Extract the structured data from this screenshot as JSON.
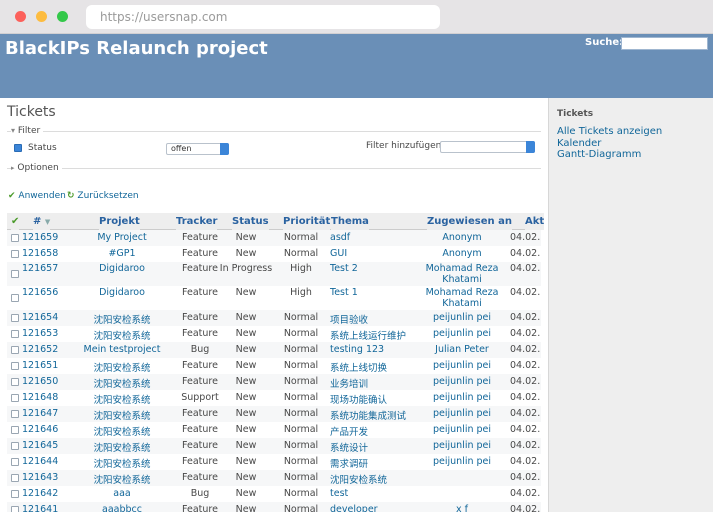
{
  "browser": {
    "url": "https://usersnap.com"
  },
  "header": {
    "project_title": "BlackIPs Relaunch project",
    "search_label": "Suche:"
  },
  "main": {
    "title": "Tickets",
    "filter_legend": "Filter",
    "status_label": "Status",
    "status_value": "offen",
    "add_filter_label": "Filter hinzufügen",
    "options_legend": "Optionen",
    "apply_label": "Anwenden",
    "reset_label": "Zurücksetzen"
  },
  "sidebar": {
    "title": "Tickets",
    "links": [
      "Alle Tickets anzeigen",
      "Kalender",
      "Gantt-Diagramm"
    ]
  },
  "table": {
    "headers": [
      "#",
      "Projekt",
      "Tracker",
      "Status",
      "Priorität",
      "Thema",
      "Zugewiesen an",
      "Akt"
    ],
    "rows": [
      {
        "id": "121659",
        "project": "My Project",
        "tracker": "Feature",
        "status": "New",
        "priority": "Normal",
        "subject": "asdf",
        "assignee": "Anonym",
        "assignee2": "",
        "updated": "04.02."
      },
      {
        "id": "121658",
        "project": "#GP1",
        "tracker": "Feature",
        "status": "New",
        "priority": "Normal",
        "subject": "GUI",
        "assignee": "Anonym",
        "assignee2": "",
        "updated": "04.02."
      },
      {
        "id": "121657",
        "project": "Digidaroo",
        "tracker": "Feature",
        "status": "In Progress",
        "priority": "High",
        "subject": "Test 2",
        "assignee": "Mohamad Reza",
        "assignee2": "Khatami",
        "updated": "04.02."
      },
      {
        "id": "121656",
        "project": "Digidaroo",
        "tracker": "Feature",
        "status": "New",
        "priority": "High",
        "subject": "Test 1",
        "assignee": "Mohamad Reza",
        "assignee2": "Khatami",
        "updated": "04.02."
      },
      {
        "id": "121654",
        "project": "沈阳安检系统",
        "tracker": "Feature",
        "status": "New",
        "priority": "Normal",
        "subject": "项目验收",
        "assignee": "peijunlin pei",
        "assignee2": "",
        "updated": "04.02."
      },
      {
        "id": "121653",
        "project": "沈阳安检系统",
        "tracker": "Feature",
        "status": "New",
        "priority": "Normal",
        "subject": "系统上线运行维护",
        "assignee": "peijunlin pei",
        "assignee2": "",
        "updated": "04.02."
      },
      {
        "id": "121652",
        "project": "Mein testproject",
        "tracker": "Bug",
        "status": "New",
        "priority": "Normal",
        "subject": "testing 123",
        "assignee": "Julian Peter",
        "assignee2": "",
        "updated": "04.02."
      },
      {
        "id": "121651",
        "project": "沈阳安检系统",
        "tracker": "Feature",
        "status": "New",
        "priority": "Normal",
        "subject": "系统上线切换",
        "assignee": "peijunlin pei",
        "assignee2": "",
        "updated": "04.02."
      },
      {
        "id": "121650",
        "project": "沈阳安检系统",
        "tracker": "Feature",
        "status": "New",
        "priority": "Normal",
        "subject": "业务培训",
        "assignee": "peijunlin pei",
        "assignee2": "",
        "updated": "04.02."
      },
      {
        "id": "121648",
        "project": "沈阳安检系统",
        "tracker": "Support",
        "status": "New",
        "priority": "Normal",
        "subject": "现场功能确认",
        "assignee": "peijunlin pei",
        "assignee2": "",
        "updated": "04.02."
      },
      {
        "id": "121647",
        "project": "沈阳安检系统",
        "tracker": "Feature",
        "status": "New",
        "priority": "Normal",
        "subject": "系统功能集成测试",
        "assignee": "peijunlin pei",
        "assignee2": "",
        "updated": "04.02."
      },
      {
        "id": "121646",
        "project": "沈阳安检系统",
        "tracker": "Feature",
        "status": "New",
        "priority": "Normal",
        "subject": "产品开发",
        "assignee": "peijunlin pei",
        "assignee2": "",
        "updated": "04.02."
      },
      {
        "id": "121645",
        "project": "沈阳安检系统",
        "tracker": "Feature",
        "status": "New",
        "priority": "Normal",
        "subject": "系统设计",
        "assignee": "peijunlin pei",
        "assignee2": "",
        "updated": "04.02."
      },
      {
        "id": "121644",
        "project": "沈阳安检系统",
        "tracker": "Feature",
        "status": "New",
        "priority": "Normal",
        "subject": "需求调研",
        "assignee": "peijunlin pei",
        "assignee2": "",
        "updated": "04.02."
      },
      {
        "id": "121643",
        "project": "沈阳安检系统",
        "tracker": "Feature",
        "status": "New",
        "priority": "Normal",
        "subject": "沈阳安检系统",
        "assignee": "",
        "assignee2": "",
        "updated": "04.02."
      },
      {
        "id": "121642",
        "project": "aaa",
        "tracker": "Bug",
        "status": "New",
        "priority": "Normal",
        "subject": "test",
        "assignee": "",
        "assignee2": "",
        "updated": "04.02."
      },
      {
        "id": "121641",
        "project": "aaabbcc",
        "tracker": "Feature",
        "status": "New",
        "priority": "Normal",
        "subject": "developer",
        "assignee": "x f",
        "assignee2": "",
        "updated": "04.02."
      }
    ]
  }
}
